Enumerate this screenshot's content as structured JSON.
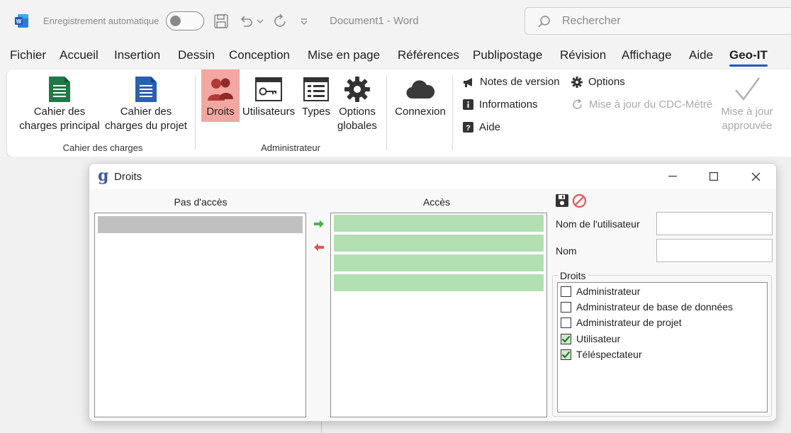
{
  "titlebar": {
    "autosave_label": "Enregistrement automatique",
    "document_title": "Document1  -  Word",
    "search_placeholder": "Rechercher"
  },
  "tabs": [
    {
      "label": "Fichier"
    },
    {
      "label": "Accueil"
    },
    {
      "label": "Insertion"
    },
    {
      "label": "Dessin"
    },
    {
      "label": "Conception"
    },
    {
      "label": "Mise en page"
    },
    {
      "label": "Références"
    },
    {
      "label": "Publipostage"
    },
    {
      "label": "Révision"
    },
    {
      "label": "Affichage"
    },
    {
      "label": "Aide"
    },
    {
      "label": "Geo-IT",
      "active": true
    }
  ],
  "ribbon": {
    "cdc_principal": {
      "line1": "Cahier des",
      "line2": "charges principal"
    },
    "cdc_projet": {
      "line1": "Cahier des",
      "line2": "charges du projet"
    },
    "group_cdc": "Cahier des charges",
    "droits": "Droits",
    "utilisateurs": "Utilisateurs",
    "types": "Types",
    "options_globales": {
      "line1": "Options",
      "line2": "globales"
    },
    "group_admin": "Administrateur",
    "connexion": "Connexion",
    "notes_version": "Notes de version",
    "informations": "Informations",
    "aide": "Aide",
    "options": "Options",
    "maj_cdc": "Mise à jour du CDC-Métré",
    "maj_approuvee": {
      "line1": "Mise à jour",
      "line2": "approuvée"
    }
  },
  "dialog": {
    "logo": "g",
    "title": "Droits",
    "no_access_header": "Pas d'accès",
    "access_header": "Accès",
    "user_name_label": "Nom de l'utilisateur",
    "user_name_value": "",
    "name_label": "Nom",
    "name_value": "",
    "rights_legend": "Droits",
    "rights": [
      {
        "label": "Administrateur",
        "checked": false
      },
      {
        "label": "Administrateur de base de données",
        "checked": false
      },
      {
        "label": "Administrateur de projet",
        "checked": false
      },
      {
        "label": "Utilisateur",
        "checked": true
      },
      {
        "label": "Téléspectateur",
        "checked": true
      }
    ]
  },
  "colors": {
    "accent": "#185abd",
    "highlight": "#f3a7a3",
    "access_item": "#b2dfb2",
    "no_access_item": "#c0c0c0",
    "arrow_right": "#4caf50",
    "arrow_left": "#e05555"
  }
}
